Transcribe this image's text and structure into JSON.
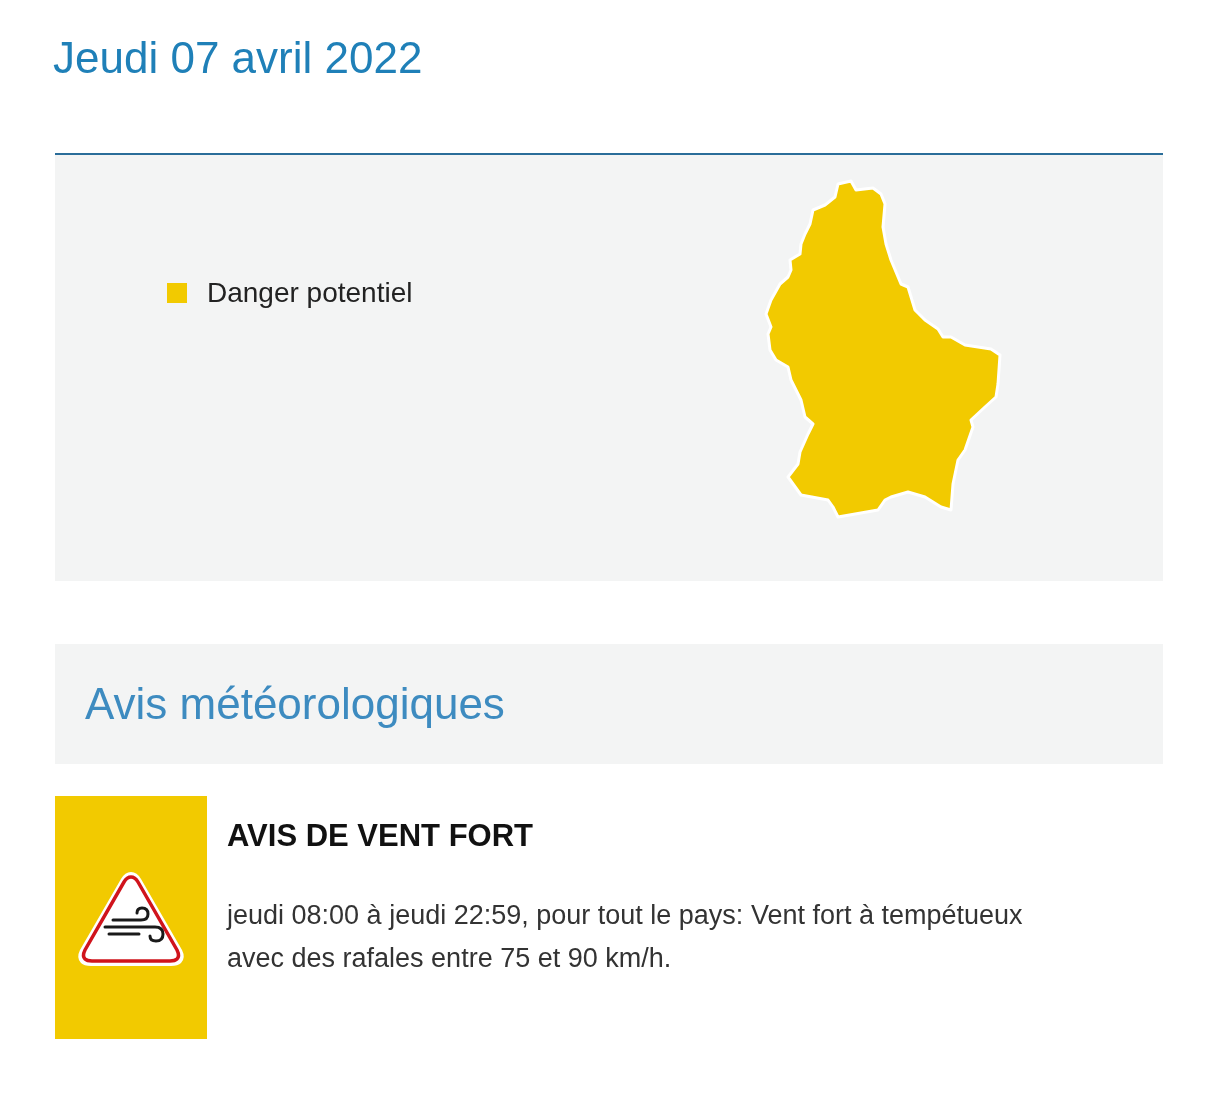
{
  "date_heading": "Jeudi 07 avril 2022",
  "map_panel": {
    "legend": [
      {
        "label": "Danger potentiel",
        "color": "#f2ca00"
      }
    ],
    "map": {
      "regions": [
        {
          "color": "#f2ca00"
        }
      ]
    }
  },
  "notices": {
    "title": "Avis météorologiques",
    "items": [
      {
        "kind": "wind",
        "color": "#f2ca00",
        "title": "AVIS DE VENT FORT",
        "description": "jeudi 08:00 à jeudi 22:59, pour tout le pays: Vent fort à tempétueux avec des rafales entre 75 et 90 km/h."
      }
    ]
  }
}
